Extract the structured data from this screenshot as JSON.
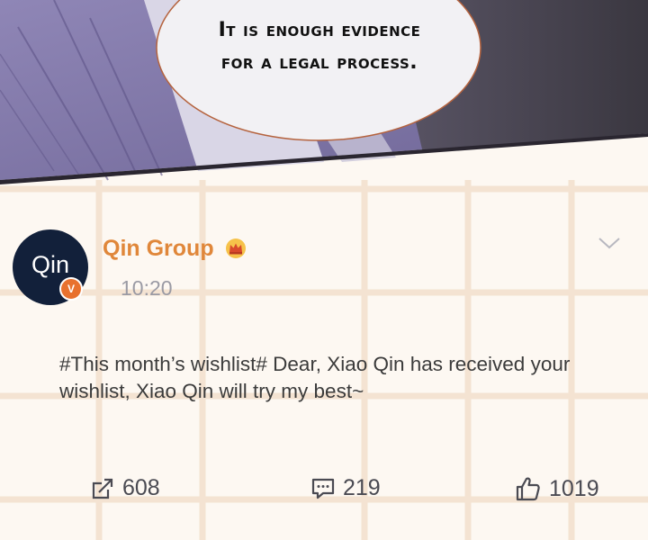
{
  "panel": {
    "speech_text": "It is enough evidence for a legal process."
  },
  "post": {
    "avatar_text": "Qin",
    "verified_badge": "V",
    "username": "Qin Group",
    "crown_icon": "crown-icon",
    "time": "10:20",
    "body": "#This month’s wishlist# Dear, Xiao Qin has received your wishlist, Xiao Qin will try my best~",
    "actions": {
      "repost_count": "608",
      "comment_count": "219",
      "like_count": "1019"
    }
  },
  "colors": {
    "username": "#e0873a",
    "avatar_bg": "#12203a",
    "badge": "#e8712e",
    "grid": "#f4e3d2"
  }
}
